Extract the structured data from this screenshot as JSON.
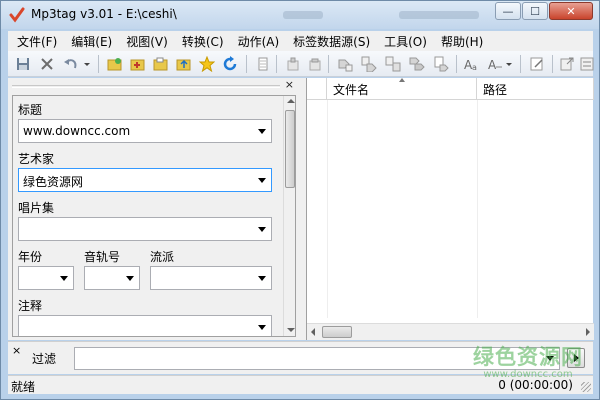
{
  "window": {
    "title": "Mp3tag v3.01  -  E:\\ceshi\\",
    "controls": {
      "minimize": "—",
      "maximize": "☐",
      "close": "✕"
    }
  },
  "menu": [
    "文件(F)",
    "编辑(E)",
    "视图(V)",
    "转换(C)",
    "动作(A)",
    "标签数据源(S)",
    "工具(O)",
    "帮助(H)"
  ],
  "toolbar": {
    "icons": [
      "save-icon",
      "remove-tag-icon",
      "undo-icon",
      "undo-dropdown-icon",
      "open-folder-icon",
      "add-directory-icon",
      "add-folder-icon",
      "open-folder-up-icon",
      "favorite-star-icon",
      "refresh-icon",
      "document-icon",
      "copy-tag-icon",
      "paste-tag-icon",
      "tag-filename-icon",
      "filename-tag-icon",
      "filename-filename-icon",
      "tag-tag-icon",
      "text-file-tag-icon",
      "case-convert-icon",
      "actions-icon",
      "actions-dropdown-icon",
      "edit-icon",
      "export-icon",
      "options-icon"
    ]
  },
  "tag_panel": {
    "close": "×",
    "fields": {
      "title": {
        "label": "标题",
        "value": "www.downcc.com"
      },
      "artist": {
        "label": "艺术家",
        "value": "绿色资源网"
      },
      "album": {
        "label": "唱片集",
        "value": ""
      },
      "year": {
        "label": "年份",
        "value": ""
      },
      "track": {
        "label": "音轨号",
        "value": ""
      },
      "genre": {
        "label": "流派",
        "value": ""
      },
      "comment": {
        "label": "注释",
        "value": ""
      }
    }
  },
  "file_list": {
    "columns": [
      "文件名",
      "路径"
    ],
    "rows": []
  },
  "filter": {
    "close": "×",
    "label": "过滤",
    "value": ""
  },
  "status": {
    "left": "就绪",
    "right": "0 (00:00:00)"
  },
  "watermark": {
    "text": "绿色资源网",
    "url": "www.downcc.com"
  },
  "colors": {
    "window_frame": "#b9d1ea",
    "accent": "#3399ff",
    "watermark": "#4caf50"
  }
}
